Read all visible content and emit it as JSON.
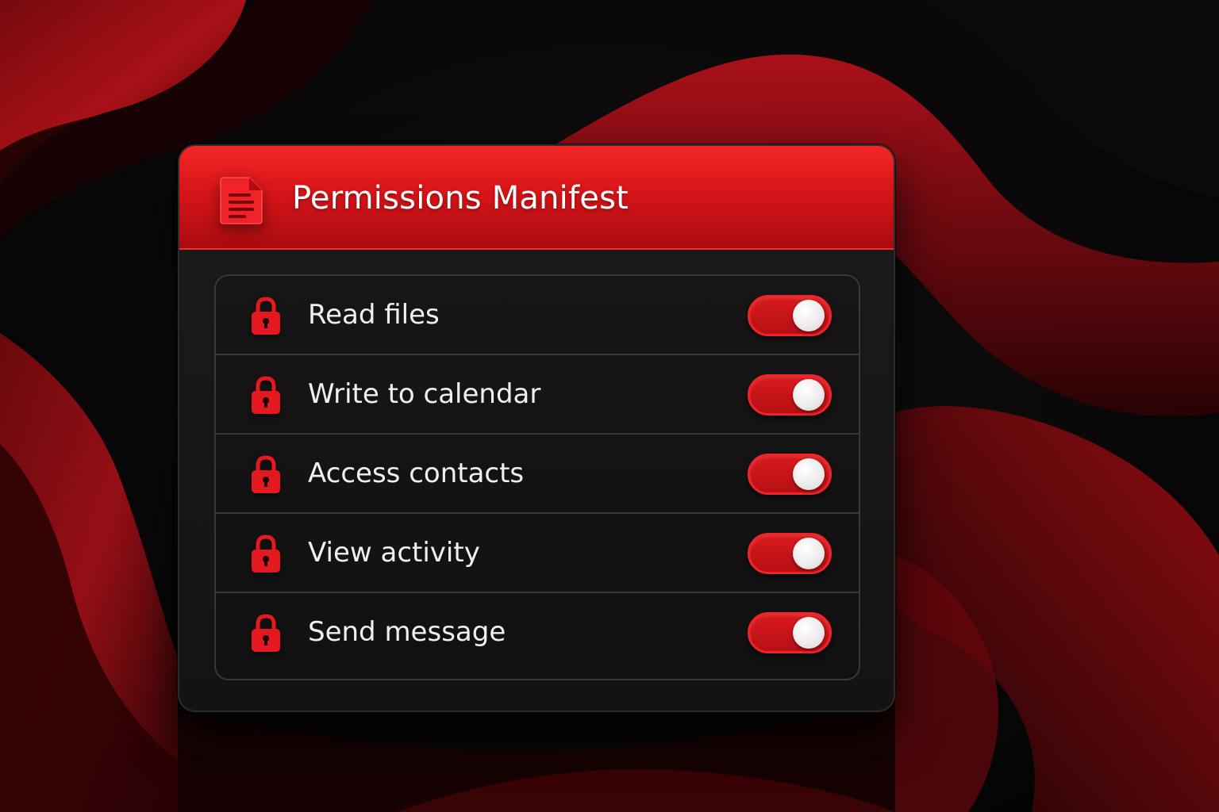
{
  "panel": {
    "title": "Permissions Manifest",
    "icon": "document-icon"
  },
  "permissions": [
    {
      "label": "Read files",
      "icon": "lock-icon",
      "enabled": true
    },
    {
      "label": "Write to calendar",
      "icon": "lock-icon",
      "enabled": true
    },
    {
      "label": "Access contacts",
      "icon": "lock-icon",
      "enabled": true
    },
    {
      "label": "View activity",
      "icon": "lock-icon",
      "enabled": true
    },
    {
      "label": "Send message",
      "icon": "lock-icon",
      "enabled": true
    }
  ],
  "colors": {
    "accent": "#e01b1f",
    "accent_bright": "#f22626",
    "background": "#070607",
    "panel": "#171516",
    "text": "#f2efef"
  }
}
